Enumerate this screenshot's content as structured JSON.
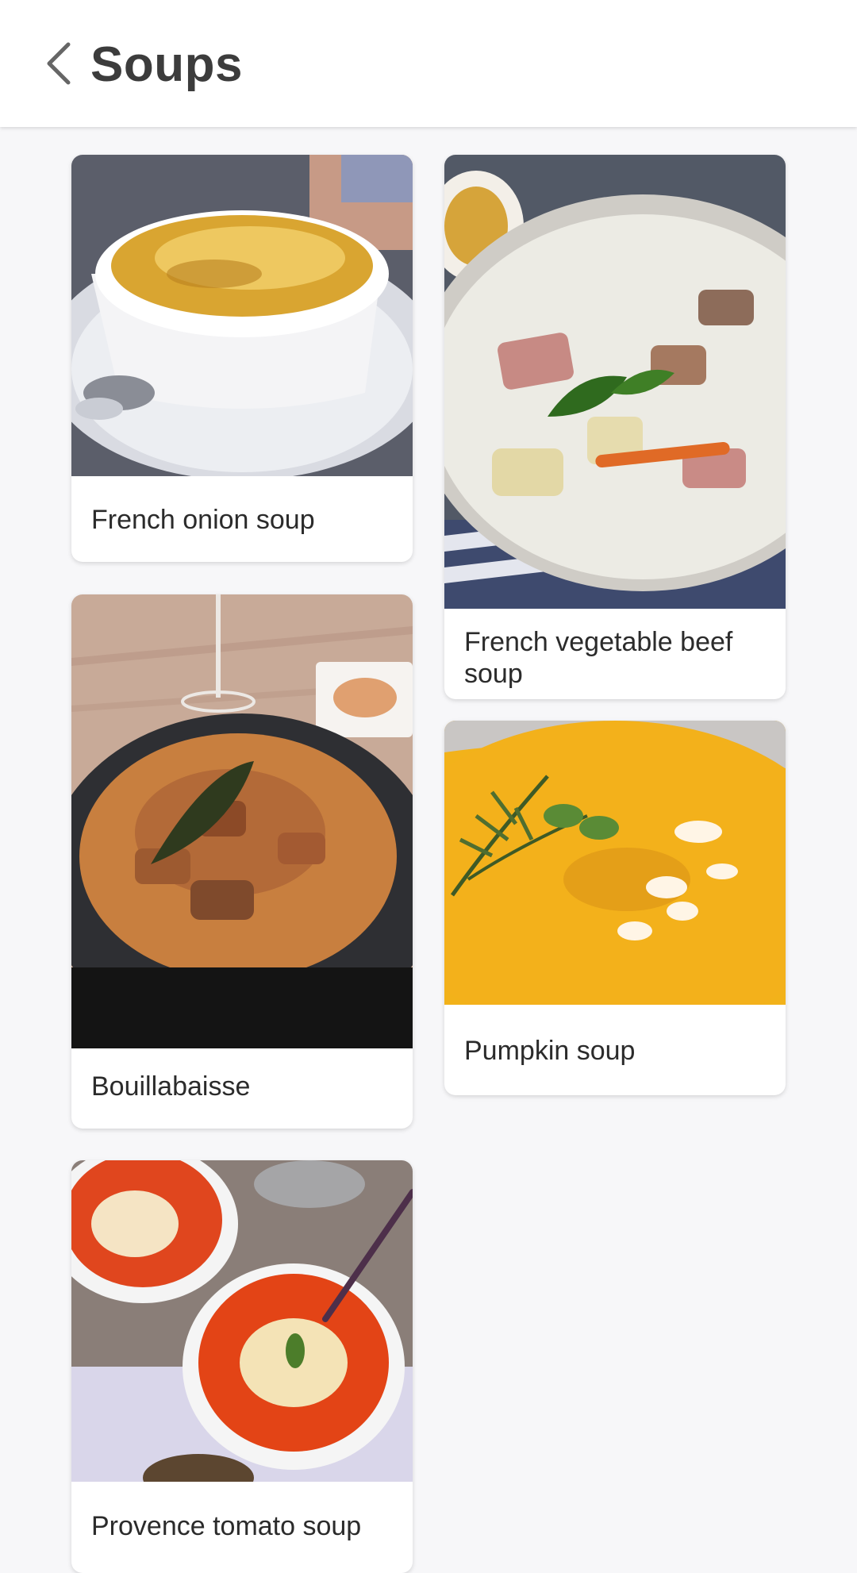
{
  "header": {
    "title": "Soups",
    "back_icon": "chevron-left-icon"
  },
  "recipes": [
    {
      "name": "French onion soup"
    },
    {
      "name": "French vegetable beef soup"
    },
    {
      "name": "Bouillabaisse"
    },
    {
      "name": "Pumpkin soup"
    },
    {
      "name": "Provence tomato soup"
    }
  ],
  "colors": {
    "background": "#f7f7f9",
    "card": "#ffffff",
    "title_text": "#3c3c3c",
    "card_text": "#2b2b2b"
  }
}
